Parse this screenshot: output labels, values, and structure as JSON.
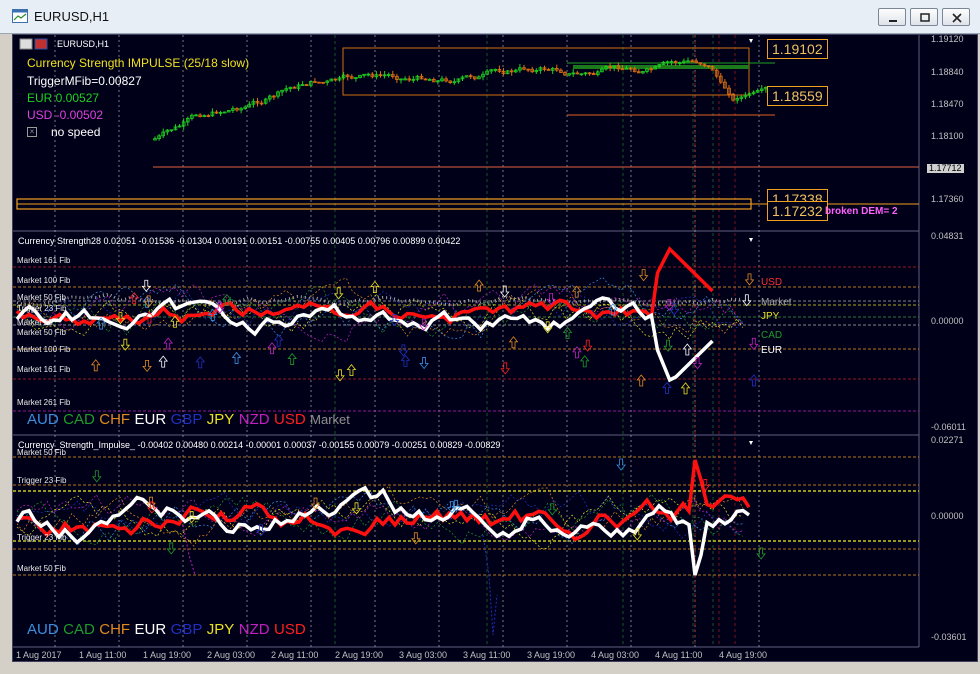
{
  "window": {
    "title": "EURUSD,H1"
  },
  "main": {
    "symbol_label": "EURUSD,H1",
    "indicator_name": "Currency Strength IMPULSE (25/18 slow)",
    "trigger": "TriggerMFib=0.00827",
    "eur": "EUR 0.00527",
    "usd": "USD -0.00502",
    "speed": "no speed",
    "levels": [
      "1.19102",
      "1.18559",
      "1.17338",
      "1.17232"
    ],
    "broken": "broken DEM= 2",
    "axis": [
      "1.19120",
      "1.18840",
      "1.18470",
      "1.18100",
      "1.17712",
      "1.17360"
    ]
  },
  "strength": {
    "header": "Currency Strength28  0.02051 -0.01536 -0.01304 0.00191 0.00151 -0.00755 0.00405 0.00796 0.00899 0.00422",
    "fibs": [
      "Market 161 Fib",
      "Market 100 Fib",
      "Market 50 Fib",
      "Trigger 23 Fib",
      "Market 23",
      "Market 50 Fib",
      "Market 100 Fib",
      "Market 161 Fib",
      "Market 261 Fib"
    ],
    "right_labels": [
      "USD",
      "Market",
      "JPY",
      "CAD",
      "EUR"
    ],
    "axis": [
      "0.04831",
      "0.00000",
      "-0.06011"
    ],
    "currencies": [
      {
        "name": "AUD",
        "color": "#3a8fe0"
      },
      {
        "name": "CAD",
        "color": "#1f9a2a"
      },
      {
        "name": "CHF",
        "color": "#e08a20"
      },
      {
        "name": "EUR",
        "color": "#ffffff"
      },
      {
        "name": "GBP",
        "color": "#2030c0"
      },
      {
        "name": "JPY",
        "color": "#e8e020"
      },
      {
        "name": "NZD",
        "color": "#c020c0"
      },
      {
        "name": "USD",
        "color": "#ff2020"
      },
      {
        "name": "Market",
        "color": "#909090"
      }
    ]
  },
  "impulse": {
    "header": "Currency_Strength_Impulse_ -0.00402 0.00480 0.00214 -0.00001 0.00037 -0.00155 0.00079 -0.00251 0.00829 -0.00829",
    "fibs": [
      "Market 50 Fib",
      "Trigger 23 Fib",
      "Trigger 23 Fib",
      "Market 50 Fib"
    ],
    "axis": [
      "0.02271",
      "0.00000",
      "-0.03601"
    ],
    "currencies": [
      "AUD",
      "CAD",
      "CHF",
      "EUR",
      "GBP",
      "JPY",
      "NZD",
      "USD"
    ]
  },
  "time_axis": [
    "1 Aug 2017",
    "1 Aug 11:00",
    "1 Aug 19:00",
    "2 Aug 03:00",
    "2 Aug 11:00",
    "2 Aug 19:00",
    "3 Aug 03:00",
    "3 Aug 11:00",
    "3 Aug 19:00",
    "4 Aug 03:00",
    "4 Aug 11:00",
    "4 Aug 19:00"
  ]
}
